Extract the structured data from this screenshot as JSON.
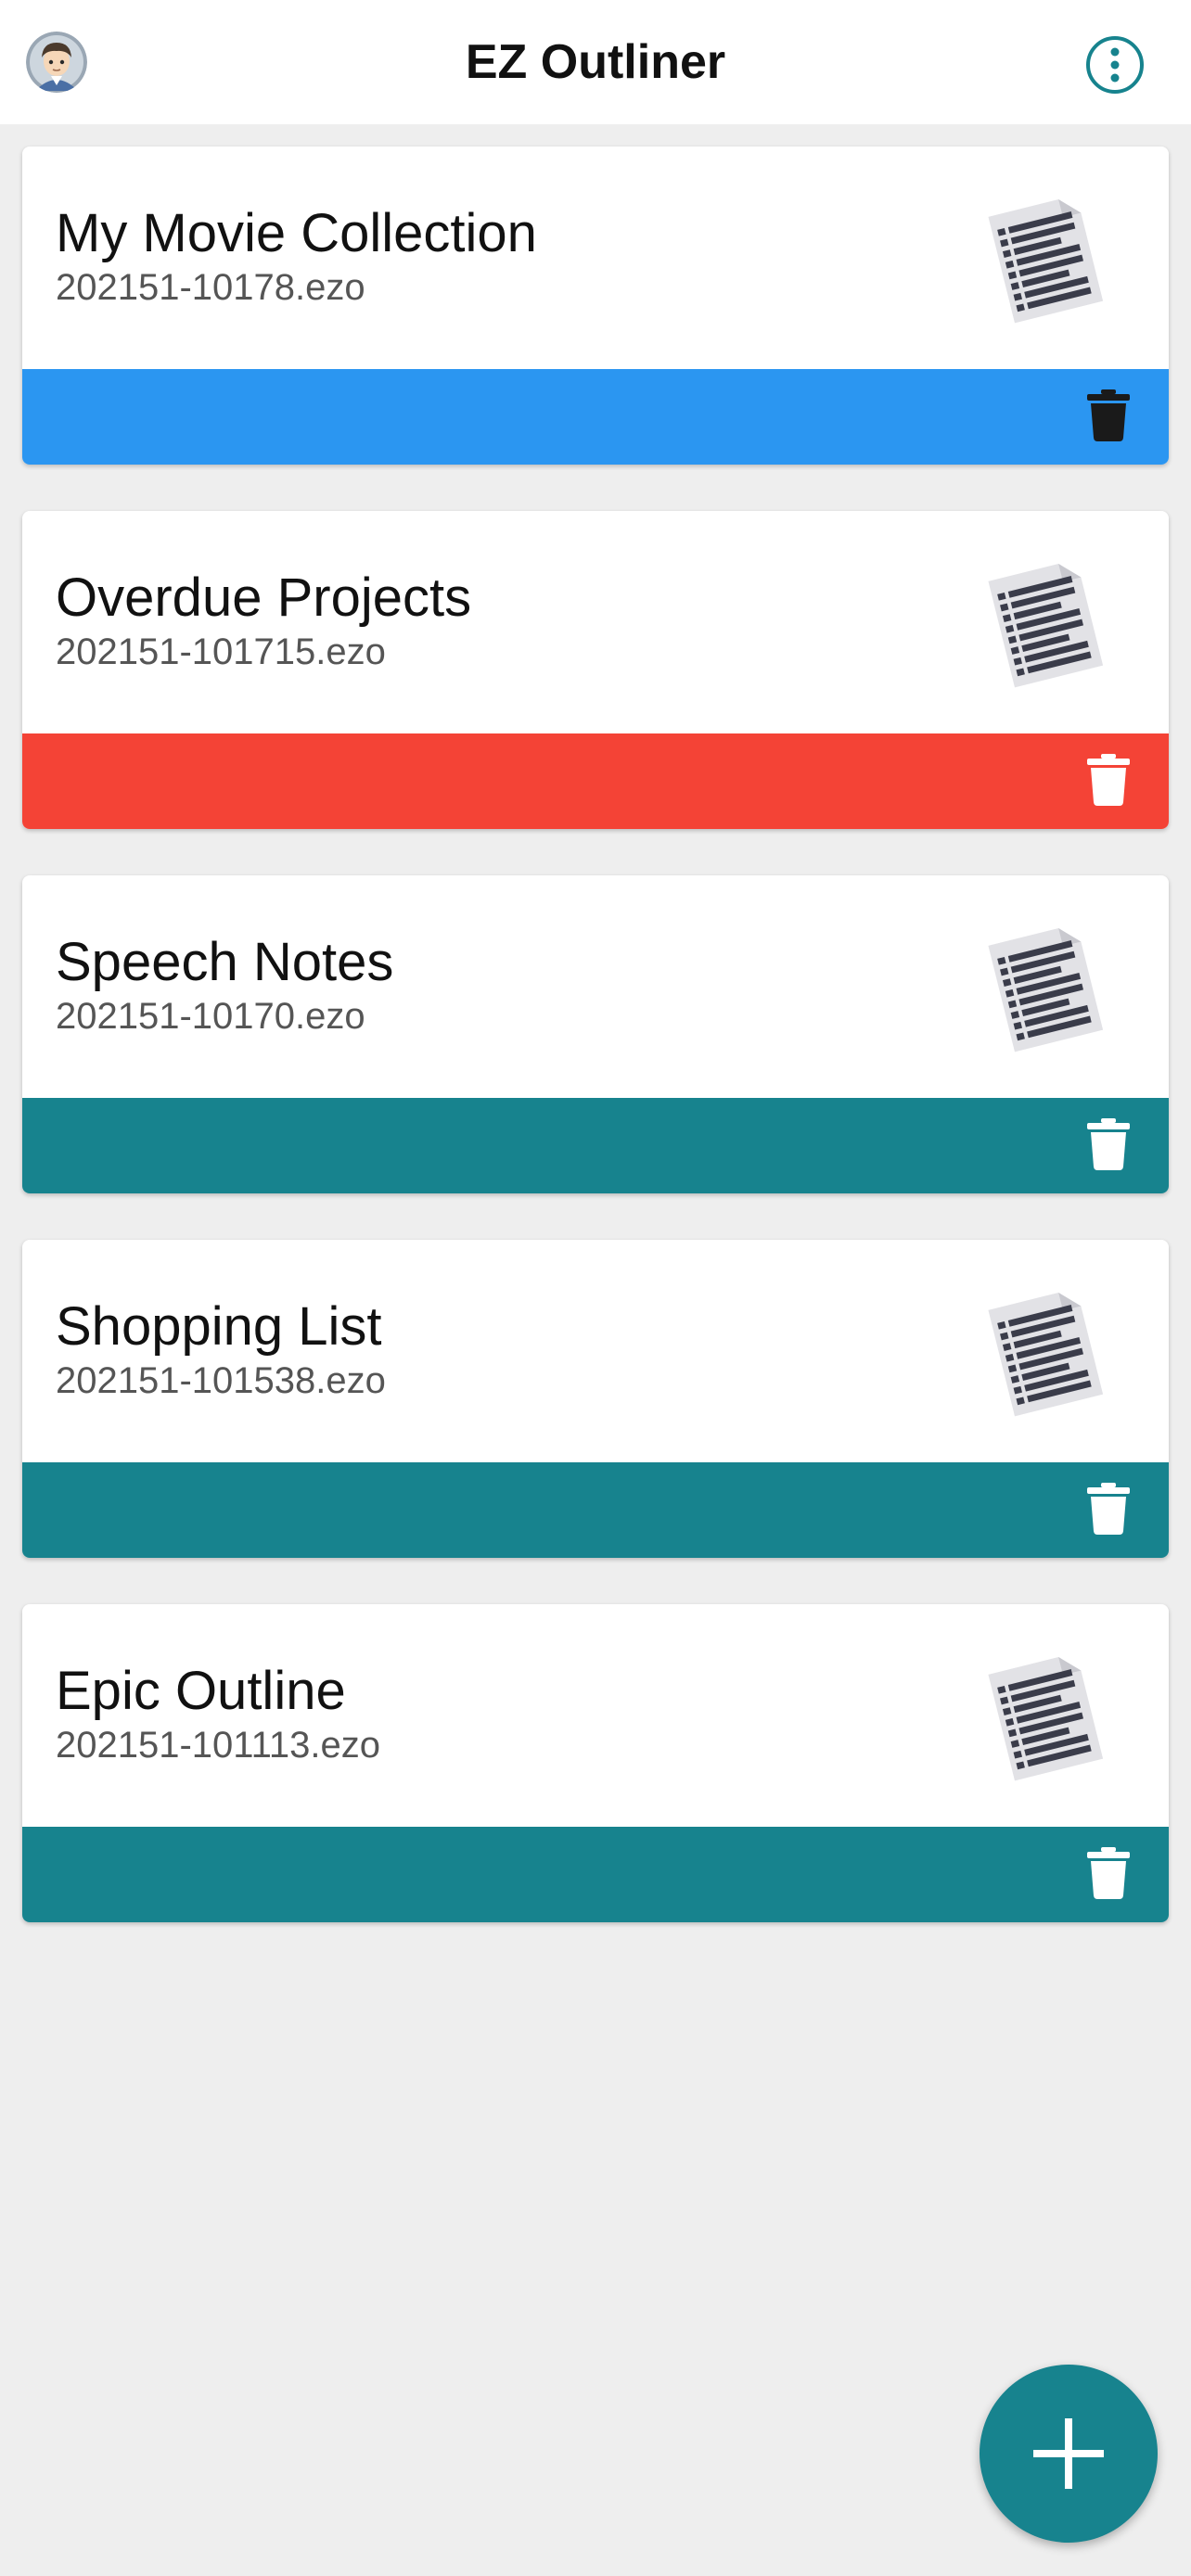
{
  "app": {
    "title": "EZ Outliner"
  },
  "colors": {
    "teal": "#17838e",
    "blue": "#2b96f1",
    "red": "#f44336"
  },
  "icons": {
    "avatar": "user-avatar",
    "menu": "more-vert-icon",
    "document": "document-icon",
    "delete": "trash-icon",
    "add": "plus-icon"
  },
  "outlines": [
    {
      "name": "My Movie Collection",
      "file": "202151-10178.ezo",
      "bar_color": "#2b96f1",
      "trash_color": "#1a1a1a"
    },
    {
      "name": "Overdue Projects",
      "file": "202151-101715.ezo",
      "bar_color": "#f44336",
      "trash_color": "#ffffff"
    },
    {
      "name": "Speech Notes",
      "file": "202151-10170.ezo",
      "bar_color": "#17838e",
      "trash_color": "#ffffff"
    },
    {
      "name": "Shopping List",
      "file": "202151-101538.ezo",
      "bar_color": "#17838e",
      "trash_color": "#ffffff"
    },
    {
      "name": "Epic Outline",
      "file": "202151-101113.ezo",
      "bar_color": "#17838e",
      "trash_color": "#ffffff"
    }
  ]
}
